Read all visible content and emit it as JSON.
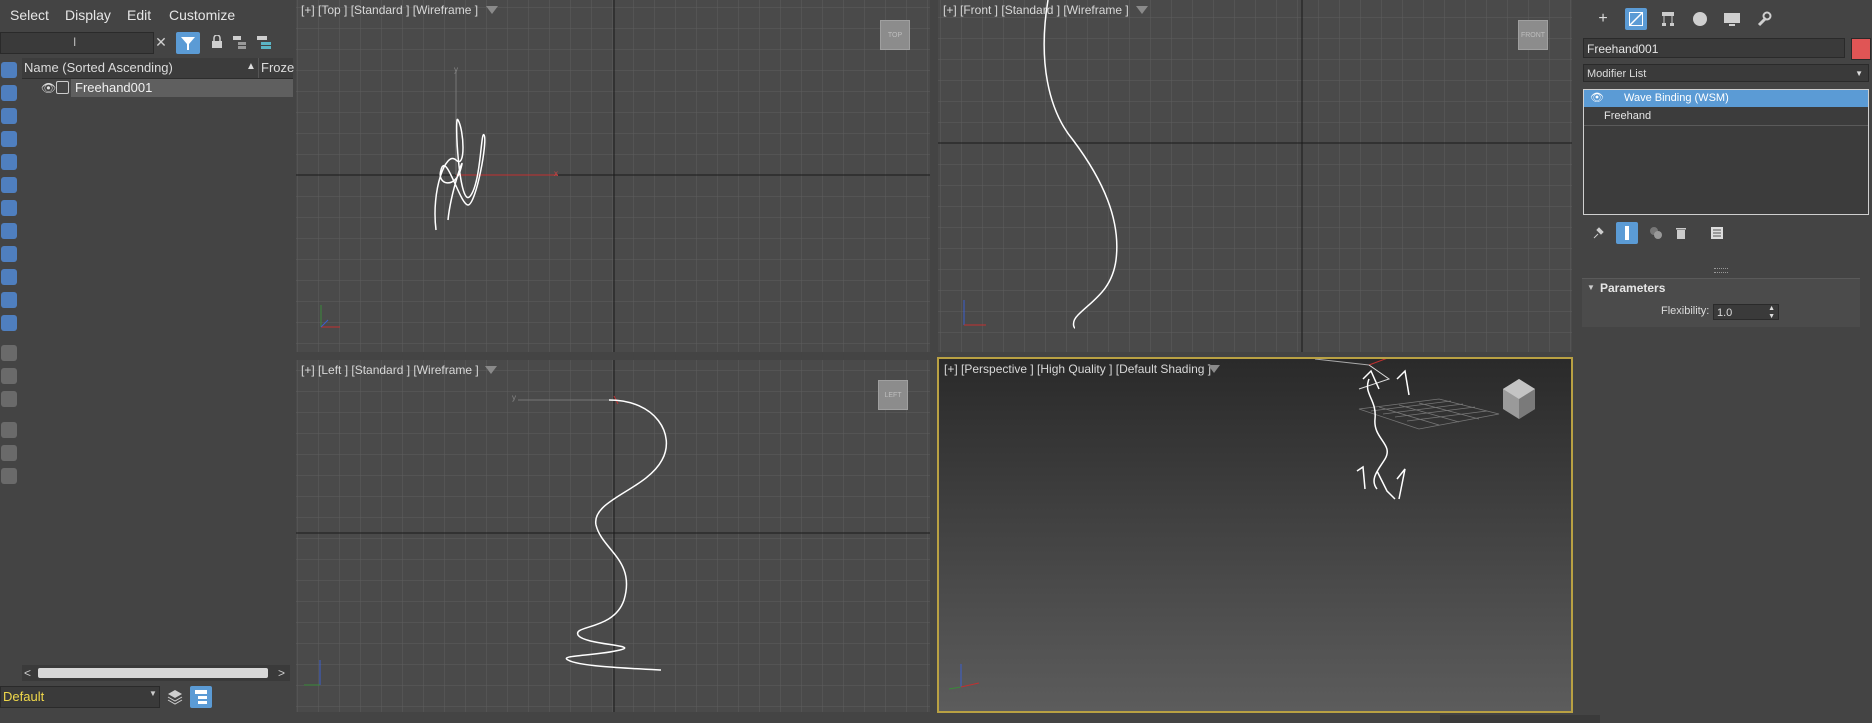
{
  "menu": [
    "Select",
    "Display",
    "Edit",
    "Customize"
  ],
  "explorer": {
    "column_name": "Name (Sorted Ascending)",
    "column_frozen": "Froze",
    "sort_indicator": "▲",
    "items": [
      {
        "name": "Freehand001"
      }
    ],
    "layer": "Default",
    "icons": [
      "search-clear-icon",
      "filter-icon",
      "lock-icon",
      "hierarchy-icon",
      "layer-explorer-icon"
    ]
  },
  "viewports": {
    "top": {
      "label": "[+] [Top ] [Standard ] [Wireframe ]",
      "cube": "TOP"
    },
    "front": {
      "label": "[+] [Front ] [Standard ] [Wireframe ]",
      "cube": "FRONT"
    },
    "left": {
      "label": "[+] [Left ] [Standard ] [Wireframe ]",
      "cube": "LEFT"
    },
    "perspective": {
      "label": "[+] [Perspective ] [High Quality ] [Default Shading ]"
    }
  },
  "command_panel": {
    "tabs": [
      "create-icon",
      "modify-icon",
      "hierarchy-icon",
      "motion-icon",
      "display-icon",
      "utilities-icon"
    ],
    "object_name": "Freehand001",
    "object_color": "#e05555",
    "modifier_list": "Modifier List",
    "stack": [
      {
        "label": "Wave Binding (WSM)",
        "selected": true
      },
      {
        "label": "Freehand",
        "selected": false
      }
    ],
    "rollout_title": "Parameters",
    "flexibility_label": "Flexibility:",
    "flexibility_value": "1.0"
  },
  "colors": {
    "accent": "#5b9bd5",
    "viewport_active_border": "#b9a143",
    "layer_text": "#f0d84a"
  }
}
